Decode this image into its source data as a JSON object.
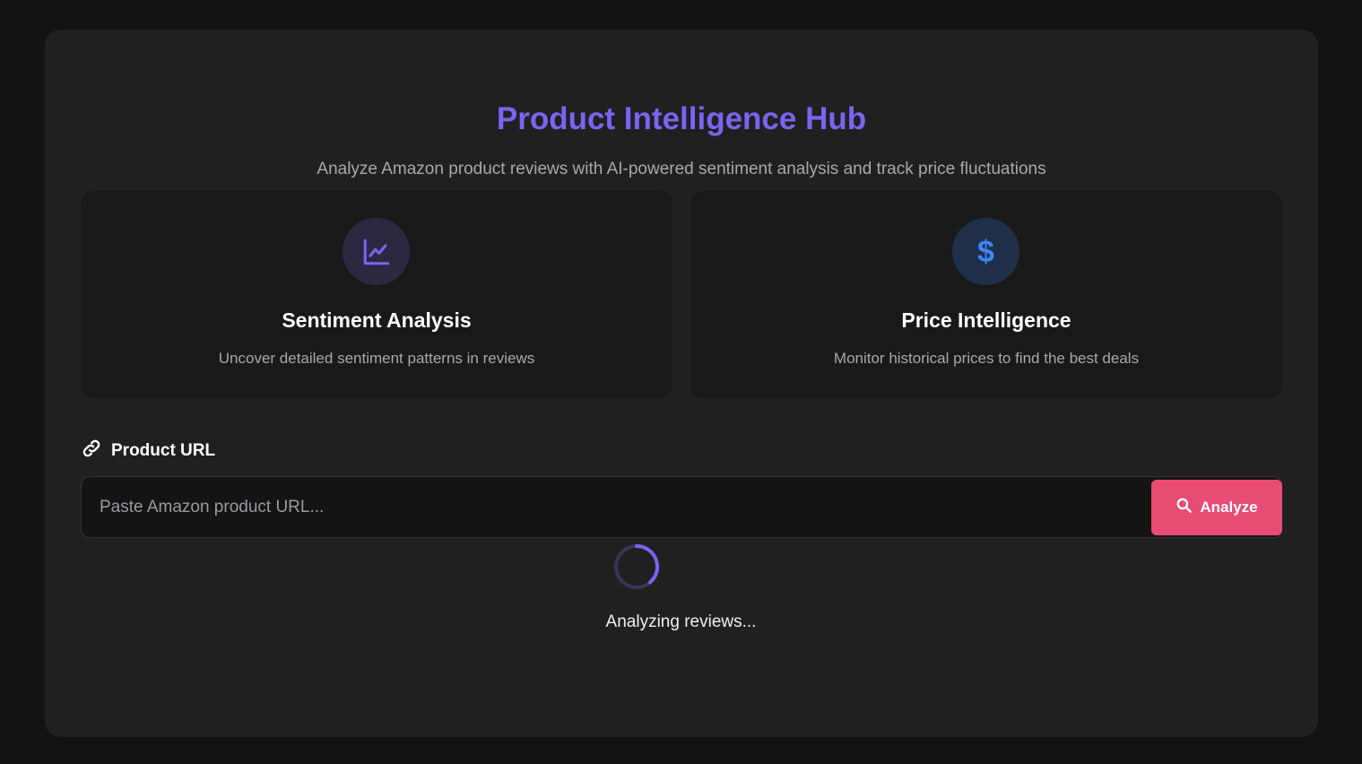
{
  "header": {
    "title": "Product Intelligence Hub",
    "subtitle": "Analyze Amazon product reviews with AI-powered sentiment analysis and track price fluctuations"
  },
  "features": [
    {
      "icon": "chart-line-icon",
      "title": "Sentiment Analysis",
      "description": "Uncover detailed sentiment patterns in reviews"
    },
    {
      "icon": "dollar-icon",
      "icon_glyph": "$",
      "title": "Price Intelligence",
      "description": "Monitor historical prices to find the best deals"
    }
  ],
  "url_form": {
    "label": "Product URL",
    "label_icon": "link-icon",
    "value": "",
    "placeholder": "Paste Amazon product URL...",
    "button_label": "Analyze",
    "button_icon": "search-icon"
  },
  "status": {
    "loading_text": "Analyzing reviews..."
  },
  "colors": {
    "background": "#131314",
    "panel": "#202021",
    "accent_purple": "#7c63f0",
    "accent_blue": "#3d86f5",
    "button_pink": "#e84b74"
  }
}
